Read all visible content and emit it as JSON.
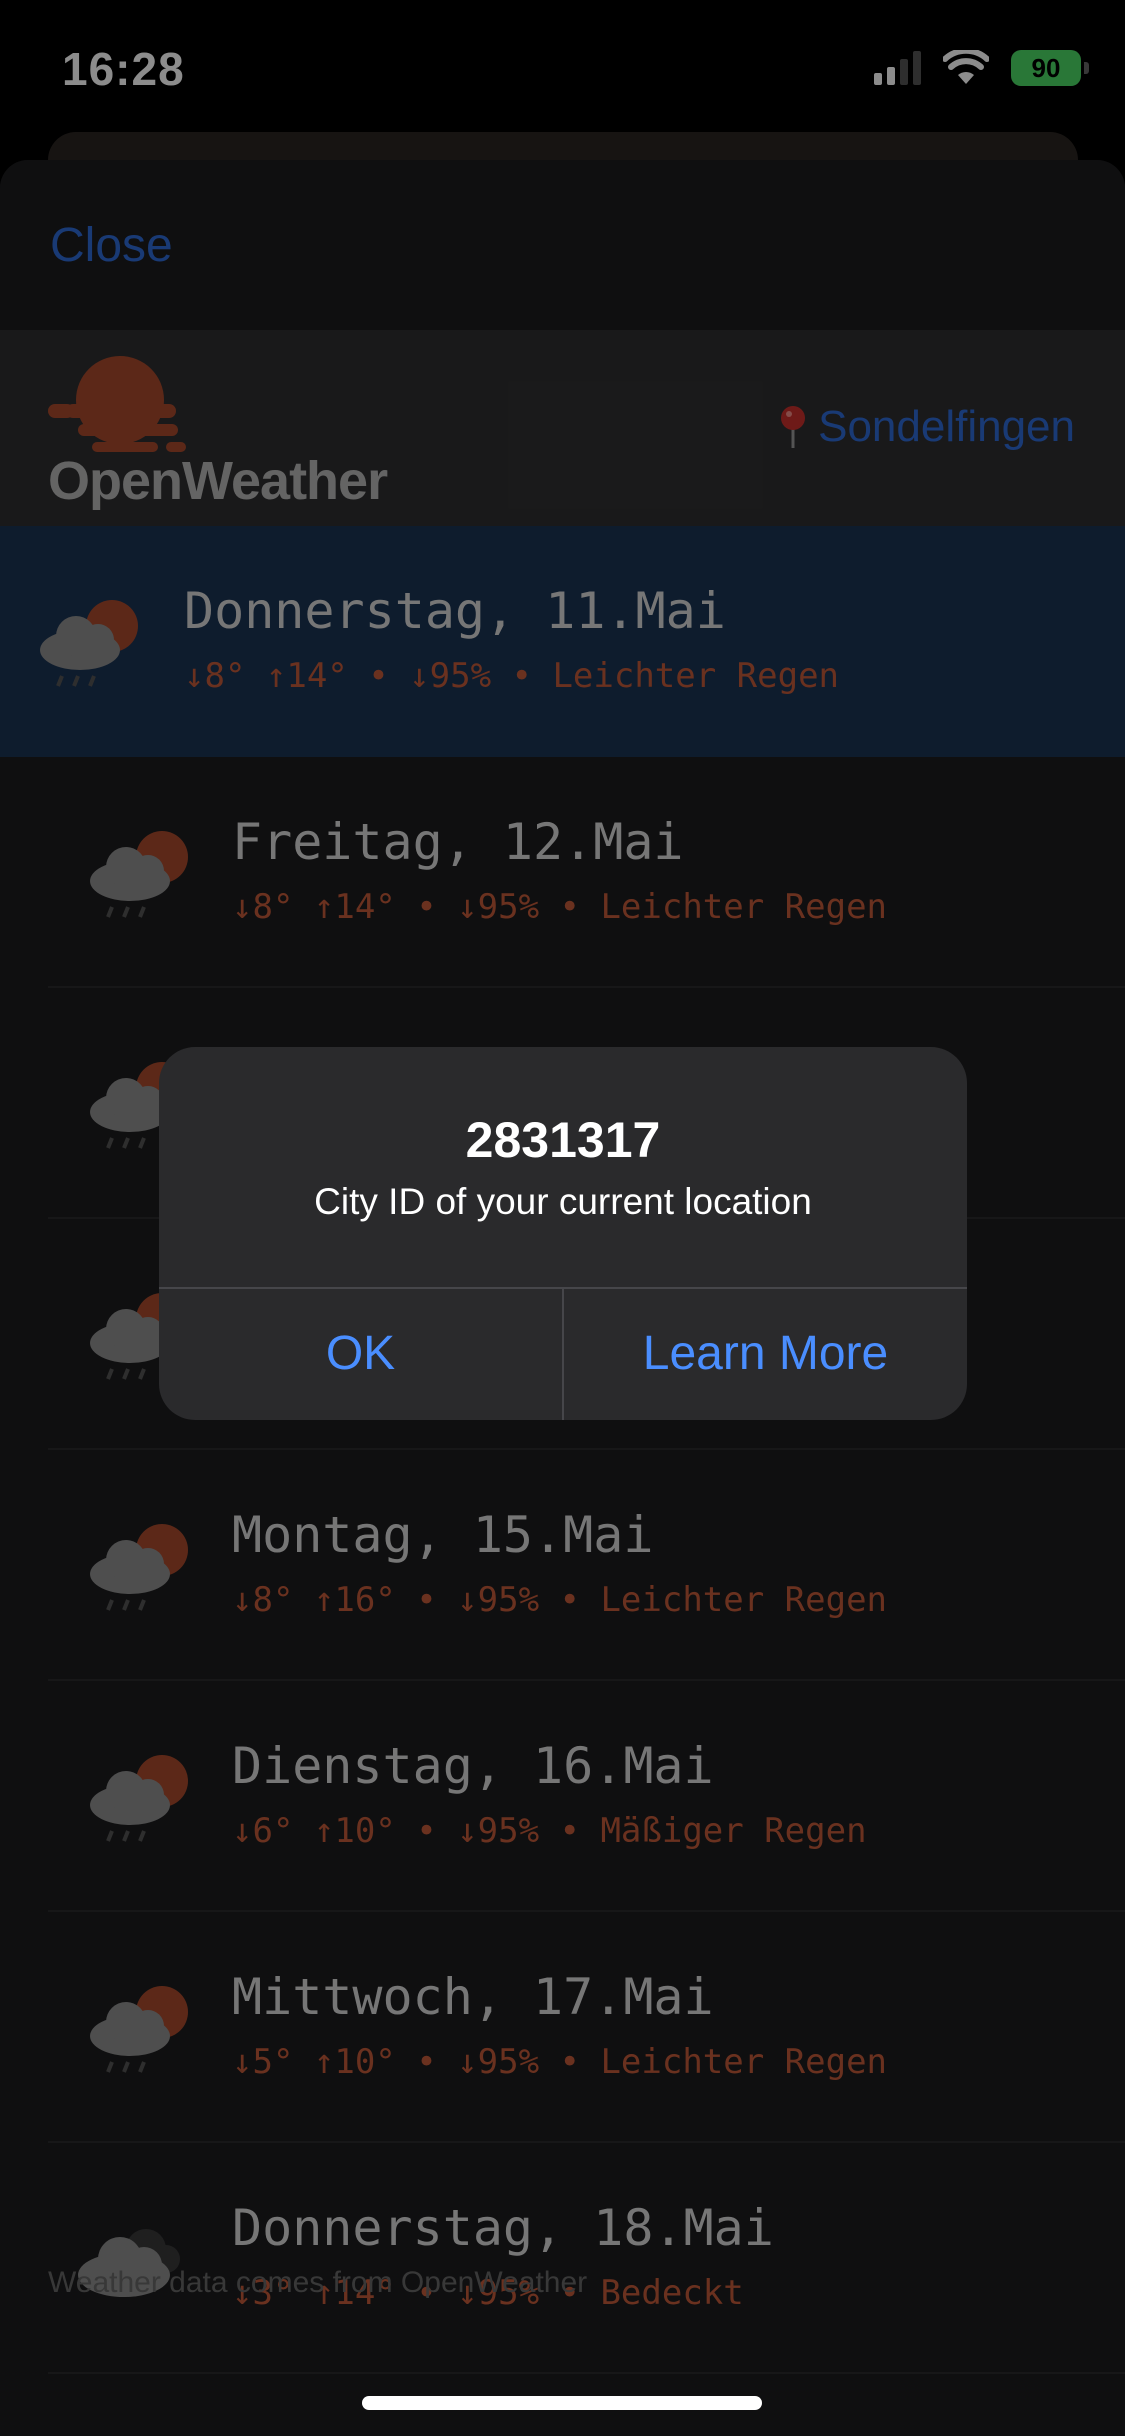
{
  "status_bar": {
    "time": "16:28",
    "battery": "90"
  },
  "header": {
    "close_label": "Close"
  },
  "brand": {
    "name": "OpenWeather",
    "location": "Sondelfingen"
  },
  "days": [
    {
      "title": "Donnerstag, 11.Mai",
      "detail": "↓8° ↑14° • ↓95% • Leichter Regen",
      "icon": "rain-cloud-sun-icon",
      "active": true
    },
    {
      "title": "Freitag, 12.Mai",
      "detail": "↓8° ↑14° • ↓95% • Leichter Regen",
      "icon": "rain-cloud-sun-icon"
    },
    {
      "title": "",
      "detail": "",
      "icon": "rain-cloud-sun-icon"
    },
    {
      "title": "",
      "detail": "",
      "icon": "rain-cloud-sun-icon"
    },
    {
      "title": "Montag, 15.Mai",
      "detail": "↓8° ↑16° • ↓95% • Leichter Regen",
      "icon": "rain-cloud-sun-icon"
    },
    {
      "title": "Dienstag, 16.Mai",
      "detail": "↓6° ↑10° • ↓95% • Mäßiger Regen",
      "icon": "rain-cloud-sun-icon"
    },
    {
      "title": "Mittwoch, 17.Mai",
      "detail": "↓5° ↑10° • ↓95% • Leichter Regen",
      "icon": "rain-cloud-sun-icon"
    },
    {
      "title": "Donnerstag, 18.Mai",
      "detail": "↓3° ↑14° • ↓95% • Bedeckt",
      "icon": "overcast-cloud-icon"
    }
  ],
  "footer": {
    "text": "Weather data comes from OpenWeather"
  },
  "alert": {
    "title": "2831317",
    "message": "City ID of your current location",
    "ok_label": "OK",
    "more_label": "Learn More"
  },
  "colors": {
    "accent": "#2f6bd6",
    "alert_button": "#4a8eff",
    "detail_text": "#c25a3a",
    "battery": "#4cd964",
    "active_row": "#1b3352"
  }
}
